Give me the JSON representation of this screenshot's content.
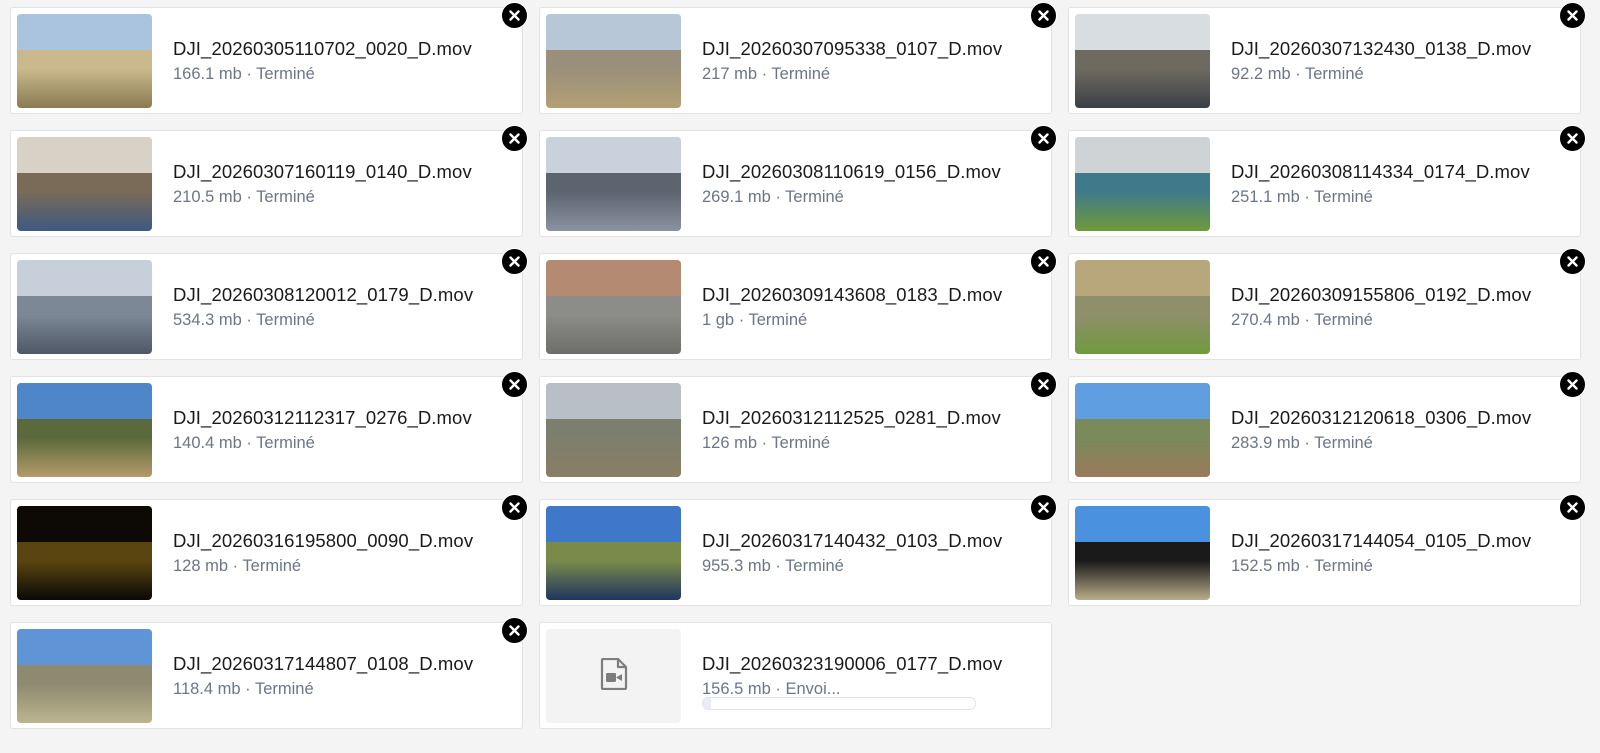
{
  "files": [
    {
      "name": "DJI_20260305110702_0020_D.mov",
      "size": "166.1 mb",
      "status": "Terminé",
      "removable": true,
      "thumb_colors": [
        "#aac4e0",
        "#c9b98c",
        "#8a7a52"
      ]
    },
    {
      "name": "DJI_20260307095338_0107_D.mov",
      "size": "217 mb",
      "status": "Terminé",
      "removable": true,
      "thumb_colors": [
        "#b8c7d8",
        "#9a8f7a",
        "#b3a073"
      ]
    },
    {
      "name": "DJI_20260307132430_0138_D.mov",
      "size": "92.2 mb",
      "status": "Terminé",
      "removable": true,
      "thumb_colors": [
        "#d8dde2",
        "#6f6a60",
        "#3a3f47"
      ]
    },
    {
      "name": "DJI_20260307160119_0140_D.mov",
      "size": "210.5 mb",
      "status": "Terminé",
      "removable": true,
      "thumb_colors": [
        "#d8d2c6",
        "#7a6a58",
        "#3d5a80"
      ]
    },
    {
      "name": "DJI_20260308110619_0156_D.mov",
      "size": "269.1 mb",
      "status": "Terminé",
      "removable": true,
      "thumb_colors": [
        "#c9d2dc",
        "#5c6470",
        "#8a93a0"
      ]
    },
    {
      "name": "DJI_20260308114334_0174_D.mov",
      "size": "251.1 mb",
      "status": "Terminé",
      "removable": true,
      "thumb_colors": [
        "#cfd3d6",
        "#3f7a8a",
        "#6f9a3a"
      ]
    },
    {
      "name": "DJI_20260308120012_0179_D.mov",
      "size": "534.3 mb",
      "status": "Terminé",
      "removable": true,
      "thumb_colors": [
        "#c7d0da",
        "#7c8896",
        "#4e5866"
      ]
    },
    {
      "name": "DJI_20260309143608_0183_D.mov",
      "size": "1 gb",
      "status": "Terminé",
      "removable": true,
      "thumb_colors": [
        "#b48a72",
        "#8c8c88",
        "#6d6d6a"
      ]
    },
    {
      "name": "DJI_20260309155806_0192_D.mov",
      "size": "270.4 mb",
      "status": "Terminé",
      "removable": true,
      "thumb_colors": [
        "#b7a77a",
        "#8f8f6a",
        "#6f9a3f"
      ]
    },
    {
      "name": "DJI_20260312112317_0276_D.mov",
      "size": "140.4 mb",
      "status": "Terminé",
      "removable": true,
      "thumb_colors": [
        "#4f86c9",
        "#5b6a3c",
        "#b59a6a"
      ]
    },
    {
      "name": "DJI_20260312112525_0281_D.mov",
      "size": "126 mb",
      "status": "Terminé",
      "removable": true,
      "thumb_colors": [
        "#b9bfc6",
        "#7d7f6e",
        "#8a7e64"
      ]
    },
    {
      "name": "DJI_20260312120618_0306_D.mov",
      "size": "283.9 mb",
      "status": "Terminé",
      "removable": true,
      "thumb_colors": [
        "#5f9ee0",
        "#7a8a5a",
        "#9a7a5a"
      ]
    },
    {
      "name": "DJI_20260316195800_0090_D.mov",
      "size": "128 mb",
      "status": "Terminé",
      "removable": true,
      "thumb_colors": [
        "#0d0a05",
        "#5a4510",
        "#0b0906"
      ]
    },
    {
      "name": "DJI_20260317140432_0103_D.mov",
      "size": "955.3 mb",
      "status": "Terminé",
      "removable": true,
      "thumb_colors": [
        "#3f78c8",
        "#7a8a4a",
        "#1e3560"
      ]
    },
    {
      "name": "DJI_20260317144054_0105_D.mov",
      "size": "152.5 mb",
      "status": "Terminé",
      "removable": true,
      "thumb_colors": [
        "#4a92e0",
        "#1a1a1a",
        "#b8ad8a"
      ]
    },
    {
      "name": "DJI_20260317144807_0108_D.mov",
      "size": "118.4 mb",
      "status": "Terminé",
      "removable": true,
      "thumb_colors": [
        "#5f95d6",
        "#8e8a70",
        "#bdb58f"
      ]
    },
    {
      "name": "DJI_20260323190006_0177_D.mov",
      "size": "156.5 mb",
      "status": "Envoi...",
      "removable": false,
      "uploading": true,
      "progress": 0.03,
      "icon": "video-file-icon"
    }
  ]
}
